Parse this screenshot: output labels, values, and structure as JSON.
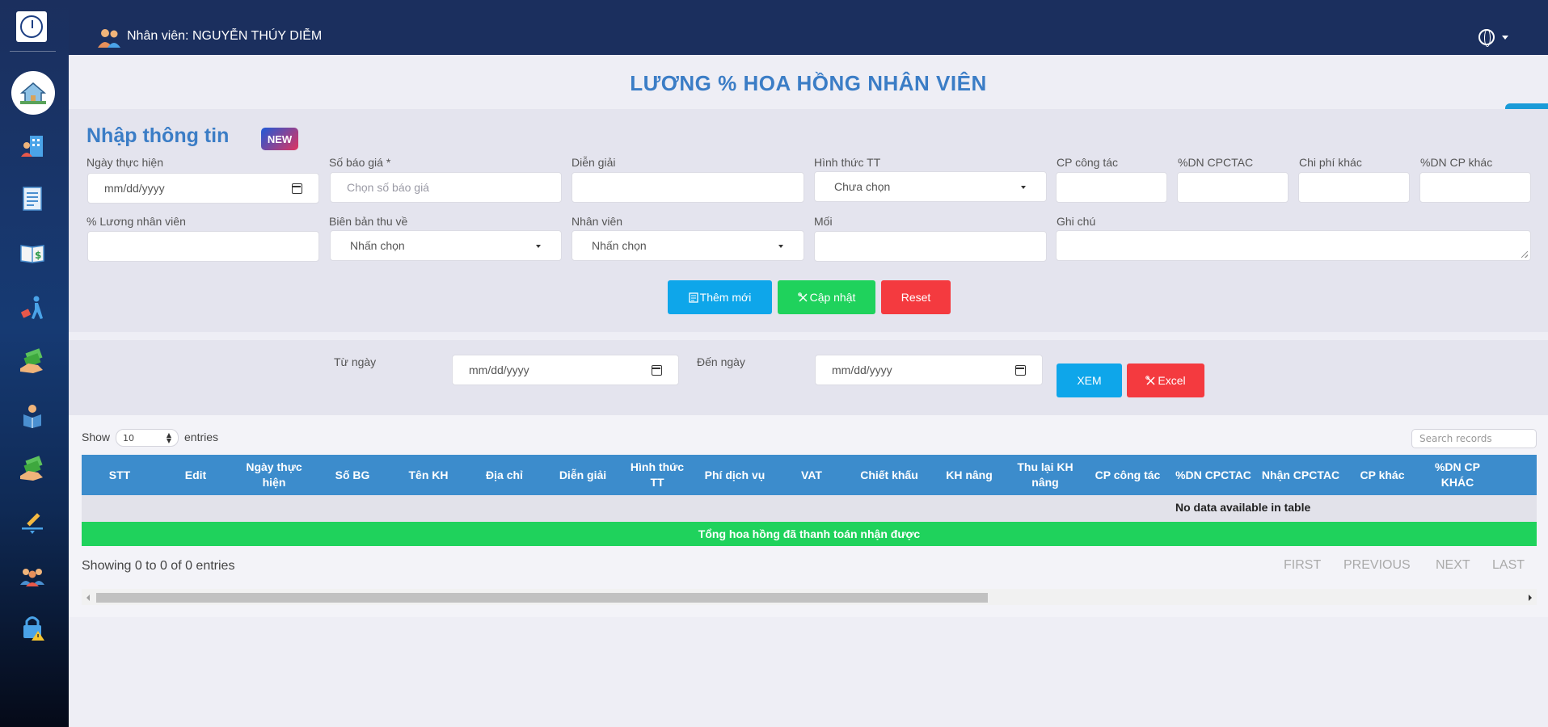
{
  "header": {
    "user_label": "Nhân viên: NGUYỄN THÚY DIỄM"
  },
  "page": {
    "title": "LƯƠNG % HOA HỒNG NHÂN VIÊN"
  },
  "form": {
    "section_title": "Nhập thông tin",
    "new_badge": "NEW",
    "fields": {
      "ngay_thuc_hien": {
        "label": "Ngày thực hiện",
        "placeholder": "mm/dd/yyyy"
      },
      "so_bao_gia": {
        "label": "Số báo giá *",
        "placeholder": "Chọn số báo giá"
      },
      "dien_giai": {
        "label": "Diễn giải",
        "value": ""
      },
      "hinh_thuc_tt": {
        "label": "Hình thức TT",
        "value": "Chưa chọn"
      },
      "cp_cong_tac": {
        "label": "CP công tác",
        "value": ""
      },
      "dn_cpctac": {
        "label": "%DN CPCTAC",
        "value": ""
      },
      "chi_phi_khac": {
        "label": "Chi phí khác",
        "value": ""
      },
      "dn_cp_khac": {
        "label": "%DN CP khác",
        "value": ""
      },
      "luong_nhan_vien": {
        "label": "% Lương nhân viên",
        "value": ""
      },
      "bien_ban_thu_ve": {
        "label": "Biên bản thu về",
        "value": "Nhấn chọn"
      },
      "nhan_vien": {
        "label": "Nhân viên",
        "value": "Nhấn chọn"
      },
      "moi": {
        "label": "Mối",
        "value": ""
      },
      "ghi_chu": {
        "label": "Ghi chú",
        "value": ""
      }
    },
    "buttons": {
      "add": "Thêm mới",
      "update": "Cập nhật",
      "reset": "Reset"
    }
  },
  "filter": {
    "from_label": "Từ ngày",
    "from_placeholder": "mm/dd/yyyy",
    "to_label": "Đến ngày",
    "to_placeholder": "mm/dd/yyyy",
    "view_button": "XEM",
    "excel_button": "Excel"
  },
  "table": {
    "show_label": "Show",
    "entries_label": "entries",
    "page_length": "10",
    "search_placeholder": "Search records",
    "columns": [
      "STT",
      "Edit",
      "Ngày thực hiện",
      "Số BG",
      "Tên KH",
      "Địa chỉ",
      "Diễn giải",
      "Hình thức TT",
      "Phí dịch vụ",
      "VAT",
      "Chiết khấu",
      "KH nâng",
      "Thu lại KH nâng",
      "CP công tác",
      "%DN CPCTAC",
      "Nhận CPCTAC",
      "CP khác",
      "%DN CP KHÁC"
    ],
    "empty_message": "No data available in table",
    "total_row": "Tổng hoa hồng đã thanh toán nhận được",
    "info": "Showing 0 to 0 of 0 entries",
    "pagination": [
      "FIRST",
      "PREVIOUS",
      "NEXT",
      "LAST"
    ]
  },
  "colors": {
    "header_bg": "#1b2f5e",
    "title": "#3b7dc6",
    "blue_button": "#0ea6ea",
    "green_button": "#1fd25c",
    "red_button": "#f43a3f",
    "table_header": "#3c8ccc"
  },
  "icons": {
    "sidebar": [
      "home-icon",
      "building-user-icon",
      "document-list-icon",
      "book-money-icon",
      "travel-icon",
      "money-hand-icon",
      "reader-icon",
      "money-hand-icon",
      "pen-sign-icon",
      "employees-icon",
      "lock-warning-icon"
    ]
  }
}
